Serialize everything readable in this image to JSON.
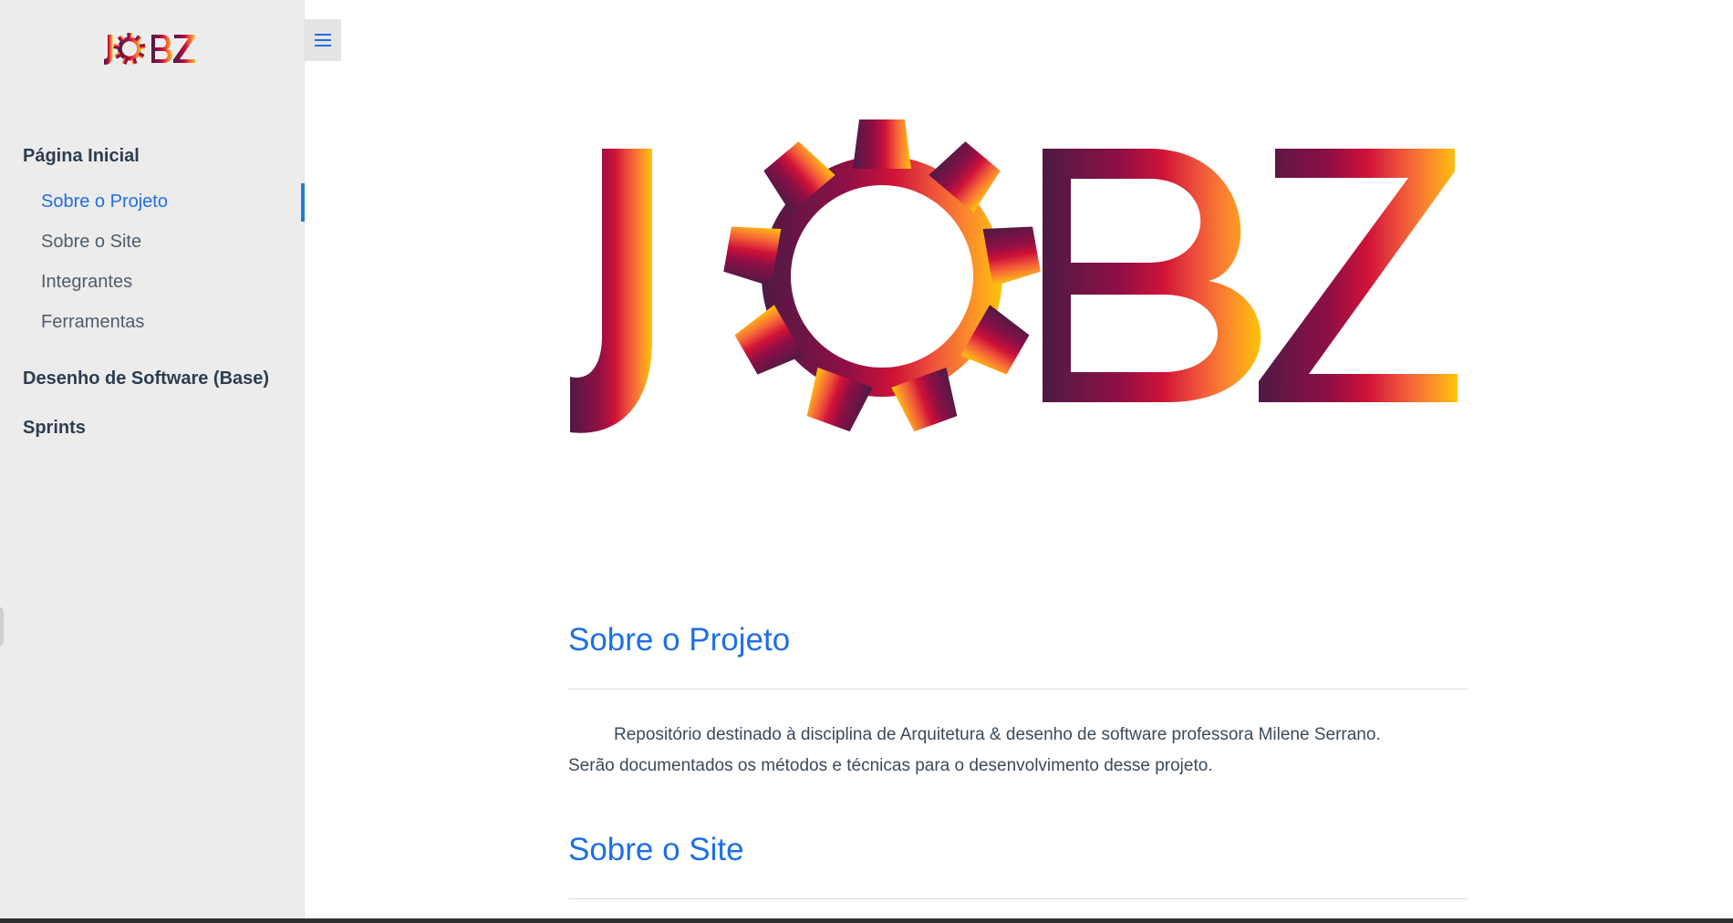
{
  "brand": {
    "logo_text": "JOBZ",
    "colors": {
      "dark": "#5a1d47",
      "mid": "#c8103e",
      "orange": "#f7853a",
      "yellow": "#ffc107",
      "link": "#1f6fe5"
    }
  },
  "sidebar": {
    "groups": [
      {
        "label": "Página Inicial",
        "items": [
          {
            "label": "Sobre o Projeto",
            "active": true
          },
          {
            "label": "Sobre o Site"
          },
          {
            "label": "Integrantes"
          },
          {
            "label": "Ferramentas"
          }
        ]
      },
      {
        "label": "Desenho de Software (Base)"
      },
      {
        "label": "Sprints"
      }
    ],
    "toggle_icon": "hamburger-icon"
  },
  "main": {
    "sections": [
      {
        "title": "Sobre o Projeto",
        "paragraph_line1": "Repositório destinado à disciplina de Arquitetura & desenho de software professora Milene Serrano.",
        "paragraph_line2": "Serão documentados os métodos e técnicas para o desenvolvimento desse projeto."
      },
      {
        "title": "Sobre o Site"
      }
    ]
  }
}
